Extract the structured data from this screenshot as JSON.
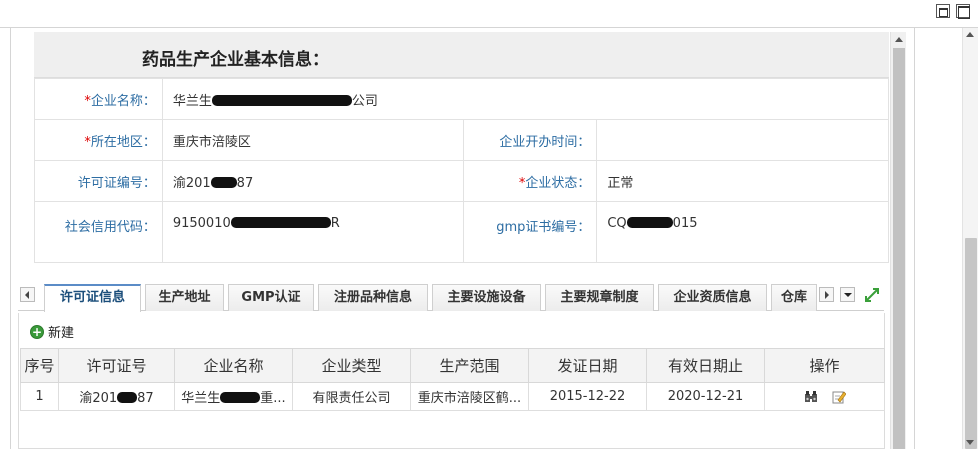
{
  "info": {
    "title": "药品生产企业基本信息：",
    "rows": [
      {
        "label": "企业名称：",
        "required": true,
        "value_prefix": "华兰生",
        "value_suffix": "公司"
      },
      {
        "label": "所在地区：",
        "required": true,
        "value": "重庆市涪陵区",
        "label2": "企业开办时间：",
        "value2": ""
      },
      {
        "label": "许可证编号：",
        "value_prefix": "渝201",
        "value_suffix": "87",
        "label2": "企业状态：",
        "required2": true,
        "value2": "正常"
      },
      {
        "label": "社会信用代码：",
        "value_prefix": "9150010",
        "value_suffix": "R",
        "label2": "gmp证书编号：",
        "value2_prefix": "CQ",
        "value2_suffix": "015"
      }
    ]
  },
  "tabs": [
    "许可证信息",
    "生产地址",
    "GMP认证",
    "注册品种信息",
    "主要设施设备",
    "主要规章制度",
    "企业资质信息",
    "仓库"
  ],
  "toolbar": {
    "new_label": "新建"
  },
  "grid": {
    "columns": [
      "序号",
      "许可证号",
      "企业名称",
      "企业类型",
      "生产范围",
      "发证日期",
      "有效日期止",
      "操作"
    ],
    "rows": [
      {
        "index": "1",
        "license_prefix": "渝201",
        "license_suffix": "87",
        "name_prefix": "华兰生",
        "name_suffix": "重...",
        "type": "有限责任公司",
        "scope": "重庆市涪陵区鹤...",
        "issue_date": "2015-12-22",
        "expire_date": "2020-12-21"
      }
    ]
  },
  "icons": [
    "restore-icon",
    "maximize-icon",
    "expand-icon",
    "add-icon",
    "view-icon",
    "edit-icon"
  ]
}
